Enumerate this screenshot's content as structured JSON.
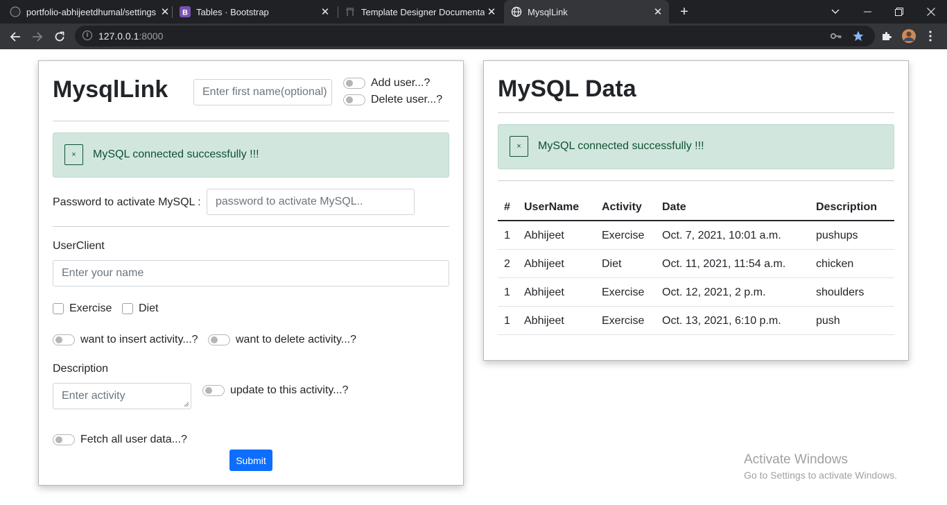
{
  "browser": {
    "tabs": [
      {
        "title": "portfolio-abhijeetdhumal/settings",
        "icon": "github-icon"
      },
      {
        "title": "Tables · Bootstrap",
        "icon": "bootstrap-icon"
      },
      {
        "title": "Template Designer Documentation",
        "icon": "jinja-icon"
      },
      {
        "title": "MysqlLink",
        "icon": "globe-icon"
      }
    ],
    "url_host": "127.0.0.1",
    "url_port": ":8000"
  },
  "left_panel": {
    "title": "MysqlLink",
    "first_name_placeholder": "Enter first name(optional)",
    "add_user_label": "Add user...?",
    "delete_user_label": "Delete user...?",
    "alert_close": "×",
    "alert_message": "MySQL connected successfully !!!",
    "password_label": "Password to activate MySQL :",
    "password_placeholder": "password to activate MySQL..",
    "userclient_label": "UserClient",
    "name_placeholder": "Enter your name",
    "exercise_label": "Exercise",
    "diet_label": "Diet",
    "insert_activity_label": "want to insert activity...?",
    "delete_activity_label": "want to delete activity...?",
    "description_label": "Description",
    "activity_placeholder": "Enter activity",
    "update_activity_label": "update to this activity...?",
    "fetch_label": "Fetch all user data...?",
    "submit_label": "Submit"
  },
  "right_panel": {
    "title": "MySQL Data",
    "alert_close": "×",
    "alert_message": "MySQL connected successfully !!!",
    "table": {
      "headers": [
        "#",
        "UserName",
        "Activity",
        "Date",
        "Description"
      ],
      "rows": [
        [
          "1",
          "Abhijeet",
          "Exercise",
          "Oct. 7, 2021, 10:01 a.m.",
          "pushups"
        ],
        [
          "2",
          "Abhijeet",
          "Diet",
          "Oct. 11, 2021, 11:54 a.m.",
          "chicken"
        ],
        [
          "1",
          "Abhijeet",
          "Exercise",
          "Oct. 12, 2021, 2 p.m.",
          "shoulders"
        ],
        [
          "1",
          "Abhijeet",
          "Exercise",
          "Oct. 13, 2021, 6:10 p.m.",
          "push"
        ]
      ]
    }
  },
  "watermark": {
    "line1": "Activate Windows",
    "line2": "Go to Settings to activate Windows."
  }
}
